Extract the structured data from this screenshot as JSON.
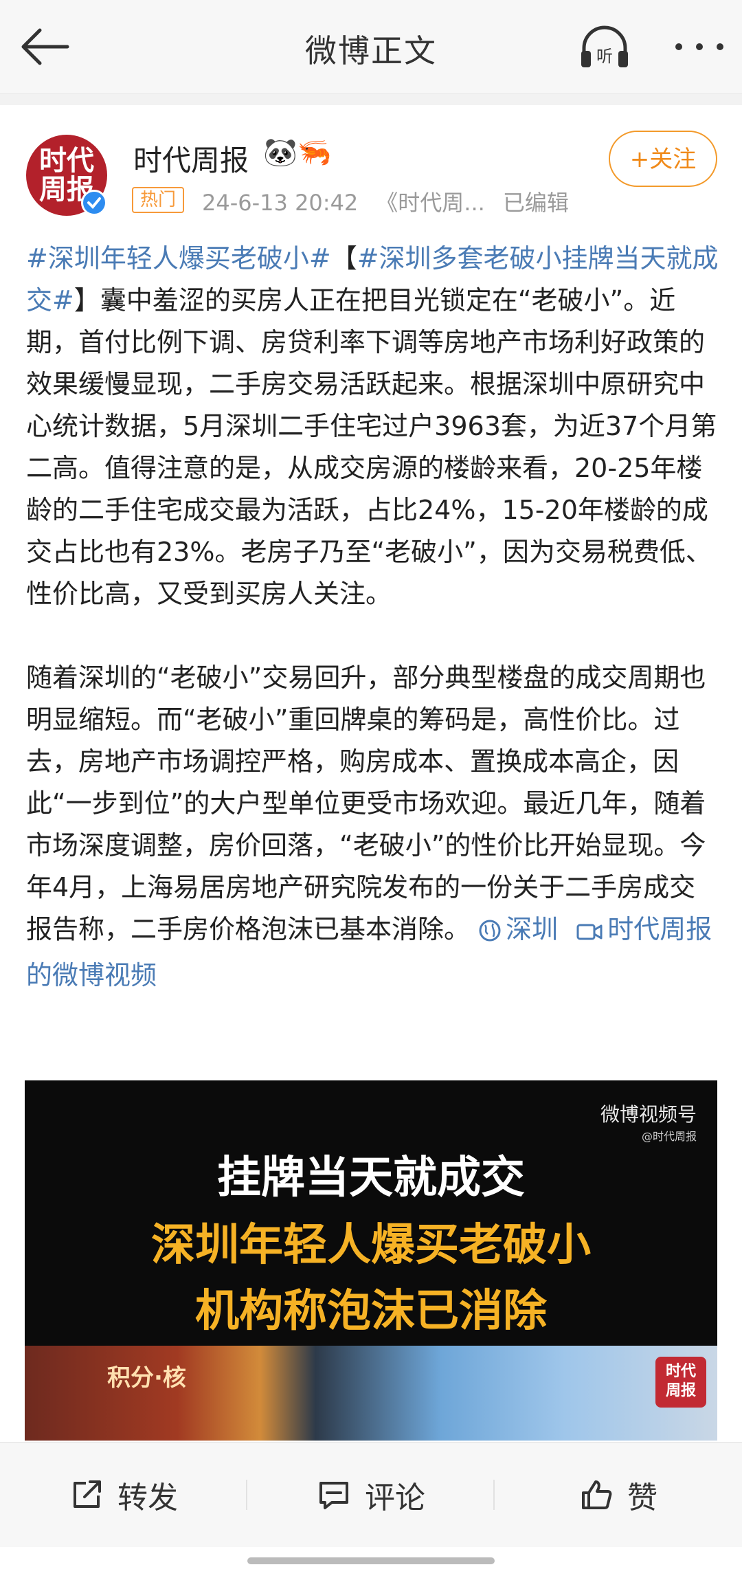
{
  "header": {
    "title": "微博正文",
    "listen_label": "听"
  },
  "author": {
    "avatar_line1": "时代",
    "avatar_line2": "周报",
    "name": "时代周报",
    "emoji": "🐼🦐",
    "hot_badge": "热门",
    "time": "24-6-13 20:42",
    "source": "《时代周...",
    "edited": "已编辑",
    "follow_label": "+关注"
  },
  "post": {
    "tag1": "#深圳年轻人爆买老破小#",
    "bracket_open": "【",
    "tag2": "#深圳多套老破小挂牌当天就成交#",
    "para1_rest": "】囊中羞涩的买房人正在把目光锁定在“老破小”。近期，首付比例下调、房贷利率下调等房地产市场利好政策的效果缓慢显现，二手房交易活跃起来。根据深圳中原研究中心统计数据，5月深圳二手住宅过户3963套，为近37个月第二高。值得注意的是，从成交房源的楼龄来看，20-25年楼龄的二手住宅成交最为活跃，占比24%，15-20年楼龄的成交占比也有23%。老房子乃至“老破小”，因为交易税费低、性价比高，又受到买房人关注。",
    "para2": "随着深圳的“老破小”交易回升，部分典型楼盘的成交周期也明显缩短。而“老破小”重回牌桌的筹码是，高性价比。过去，房地产市场调控严格，购房成本、置换成本高企，因此“一步到位”的大户型单位更受市场欢迎。最近几年，随着市场深度调整，房价回落，“老破小”的性价比开始显现。今年4月，上海易居房地产研究院发布的一份关于二手房成交报告称，二手房价格泡沫已基本消除。",
    "location_link": "深圳",
    "video_link": "时代周报的微博视频"
  },
  "video": {
    "watermark": "微博视频号",
    "watermark_sub": "@时代周报",
    "line1": "挂牌当天就成交",
    "line2": "深圳年轻人爆买老破小",
    "line3": "机构称泡沫已消除",
    "sign_text": "积分·核",
    "logo_line1": "时代",
    "logo_line2": "周报"
  },
  "actions": {
    "repost": "转发",
    "comment": "评论",
    "like": "赞"
  },
  "colors": {
    "link": "#4a7bb5",
    "accent": "#f08a1a"
  }
}
